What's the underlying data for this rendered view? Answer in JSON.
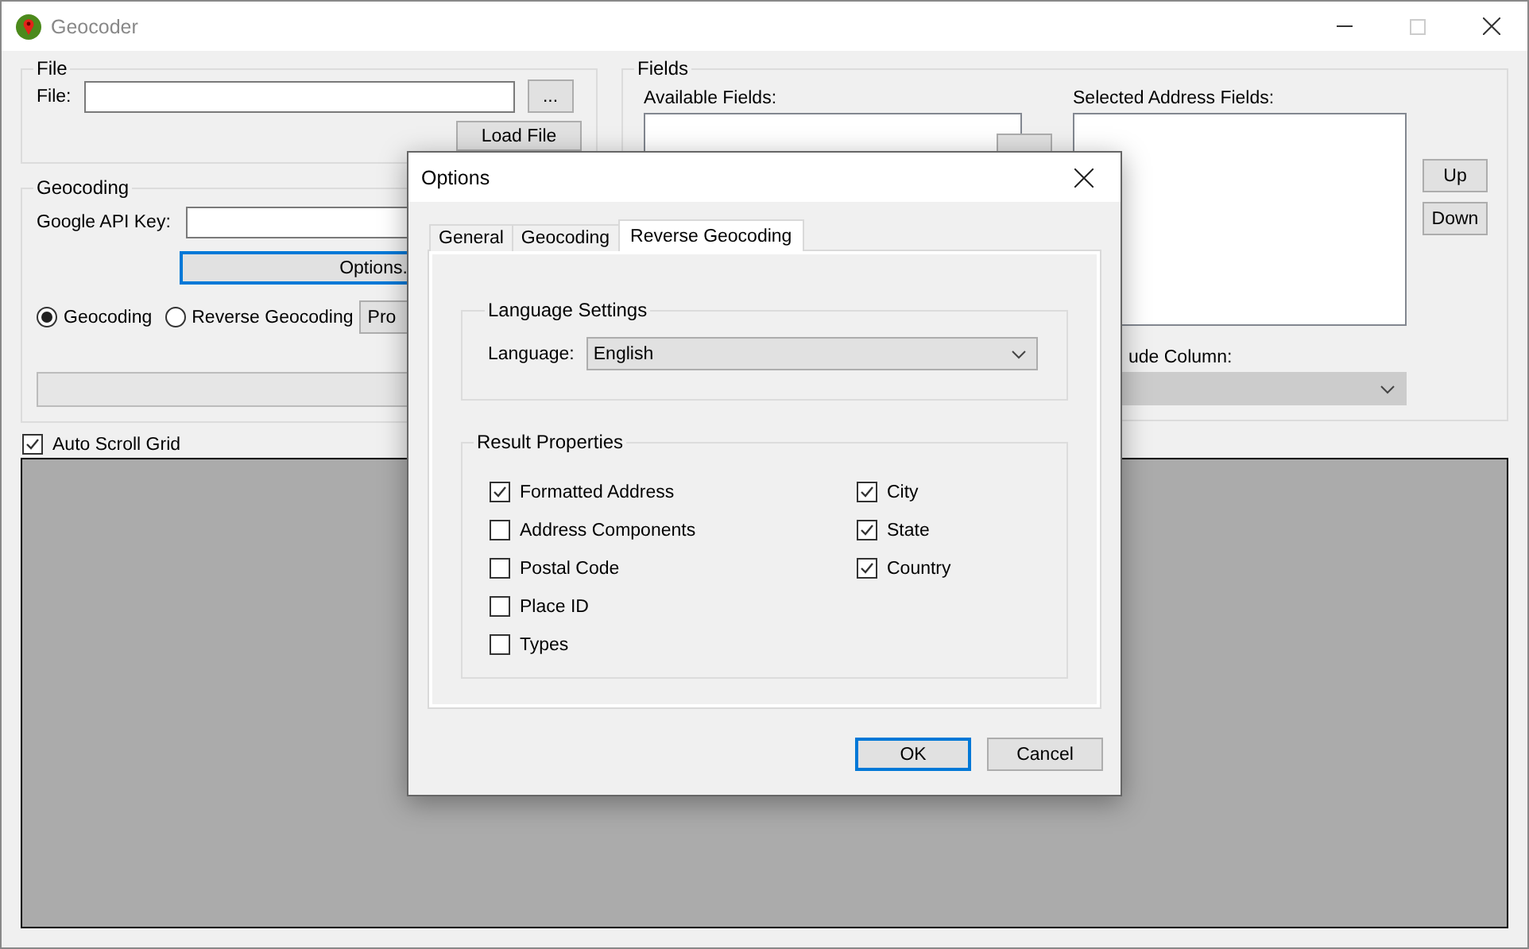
{
  "main_window": {
    "title": "Geocoder",
    "file_group": {
      "title": "File",
      "label": "File:",
      "browse_button": "...",
      "load_button": "Load File"
    },
    "geocoding_group": {
      "title": "Geocoding",
      "api_key_label": "Google API Key:",
      "options_button": "Options.",
      "modes": [
        {
          "label": "Geocoding",
          "selected": true
        },
        {
          "label": "Reverse Geocoding",
          "selected": false
        }
      ],
      "process_button": "Pro",
      "progress": {
        "level": 0
      }
    },
    "fields_group": {
      "title": "Fields",
      "available_label": "Available Fields:",
      "selected_label": "Selected Address Fields:",
      "up_button": "Up",
      "down_button": "Down",
      "column_label": "ude Column:"
    },
    "auto_scroll": {
      "label": "Auto Scroll Grid",
      "checked": true
    }
  },
  "dialog": {
    "title": "Options",
    "tabs": [
      {
        "label": "General",
        "selected": false
      },
      {
        "label": "Geocoding",
        "selected": false
      },
      {
        "label": "Reverse Geocoding",
        "selected": true
      }
    ],
    "language_group": {
      "title": "Language Settings",
      "label": "Language:",
      "value": "English"
    },
    "result_group": {
      "title": "Result Properties",
      "columns": [
        [
          {
            "label": "Formatted Address",
            "checked": true
          },
          {
            "label": "Address Components",
            "checked": false
          },
          {
            "label": "Postal Code",
            "checked": false
          },
          {
            "label": "Place ID",
            "checked": false
          },
          {
            "label": "Types",
            "checked": false
          }
        ],
        [
          {
            "label": "City",
            "checked": true
          },
          {
            "label": "State",
            "checked": true
          },
          {
            "label": "Country",
            "checked": true
          }
        ]
      ]
    },
    "buttons": [
      {
        "label": "OK",
        "kind": "default"
      },
      {
        "label": "Cancel",
        "kind": "normal"
      }
    ]
  }
}
